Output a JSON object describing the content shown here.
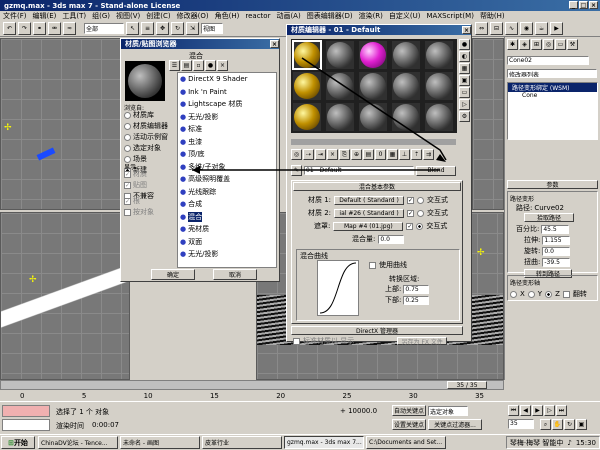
{
  "app": {
    "title": "gzmq.max - 3ds max 7 - Stand-alone License"
  },
  "menu": [
    "文件(F)",
    "编辑(E)",
    "工具(T)",
    "组(G)",
    "视图(V)",
    "创建(C)",
    "修改器(O)",
    "角色(H)",
    "reactor",
    "动画(A)",
    "图表编辑器(D)",
    "渲染(R)",
    "自定义(U)",
    "MAXScript(M)",
    "帮助(H)"
  ],
  "toolbar": {
    "selection_filter": "全部",
    "view_label": "视图"
  },
  "browser": {
    "title": "材质/贴图浏览器",
    "section_label": "混合",
    "browse_from": {
      "label": "浏览自:",
      "options": [
        "材质库",
        "材质编辑器",
        "活动示例窗",
        "选定对象",
        "场景",
        "新建"
      ],
      "selected": 5
    },
    "show": {
      "label": "显示",
      "options": [
        "材质",
        "贴图",
        "不兼容"
      ]
    },
    "extra": [
      "根",
      "按对象"
    ],
    "list": [
      "DirectX 9 Shader",
      "Ink 'n Paint",
      "Lightscape 材质",
      "无光/投影",
      "标准",
      "虫漆",
      "顶/底",
      "多维/子对象",
      "高级照明覆盖",
      "光线跟踪",
      "合成",
      "混合",
      "壳材质",
      "双面",
      "无光/投影"
    ],
    "selected_index": 11,
    "ok": "确定",
    "cancel": "取消"
  },
  "mateditor": {
    "title": "材质编辑器 - 01 - Default",
    "name_field": "01 - Default",
    "type_button": "Blend",
    "rollout_title": "混合基本参数",
    "mat1_label": "材质 1:",
    "mat1_value": "Default ( Standard )",
    "mat1_interactive": "交互式",
    "mat2_label": "材质 2:",
    "mat2_value": "ial #26 ( Standard )",
    "mat2_interactive": "交互式",
    "mask_label": "遮罩:",
    "mask_value": "Map #4 (01.jpg)",
    "mask_interactive": "交互式",
    "mix_label": "混合量:",
    "mix_value": "0.0",
    "curve_label": "混合曲线",
    "use_curve": "使用曲线",
    "transition": "转换区域:",
    "upper_label": "上部:",
    "upper_value": "0.75",
    "lower_label": "下部:",
    "lower_value": "0.25",
    "directx_title": "DirectX 管理器",
    "standard_label": "标准材质以 显示",
    "save_file": "另存为 FX 文件"
  },
  "right_panel": {
    "object_name": "Cone02",
    "modifier_list": "修改器列表",
    "stack_item": "路径变形绑定 (WSM)",
    "stack_base": "Cone",
    "params_title": "参数",
    "path_deform": "路径变形",
    "path_label": "路径:",
    "path_value": "Curve02",
    "pick_path": "拾取路径",
    "percent_label": "百分比:",
    "percent_value": "45.5",
    "stretch_label": "拉伸:",
    "stretch_value": "1.155",
    "rotate_label": "旋转:",
    "rotate_value": "0.0",
    "twist_label": "扭曲:",
    "twist_value": "-39.5",
    "to_path": "转到路径",
    "axis_title": "路径变形轴",
    "axes": [
      "X",
      "Y",
      "Z"
    ],
    "axis_selected": 2,
    "flip": "翻转"
  },
  "timeline": {
    "frame": "35 / 35",
    "ticks": [
      "0",
      "5",
      "10",
      "15",
      "20",
      "25",
      "30",
      "35"
    ]
  },
  "status": {
    "selected": "选择了 1 个 对象",
    "render_time_label": "渲染时间",
    "render_time": "0:00:07",
    "coords": "+ 10000.0",
    "auto_key": "自动关键点",
    "set_key": "设置关键点",
    "key_filter": "关键点过滤器...",
    "selection": "选定对象",
    "frame_val": "35"
  },
  "taskbar": {
    "start": "开始",
    "tasks": [
      "ChinaDV论坛 - Tence...",
      "未命名 - 画图",
      "皮革行业",
      "gzmq.max - 3ds max 7...",
      "C:\\Documents and Set..."
    ],
    "ime": "琴梅·梅琴 智能中",
    "time": "15:30"
  }
}
